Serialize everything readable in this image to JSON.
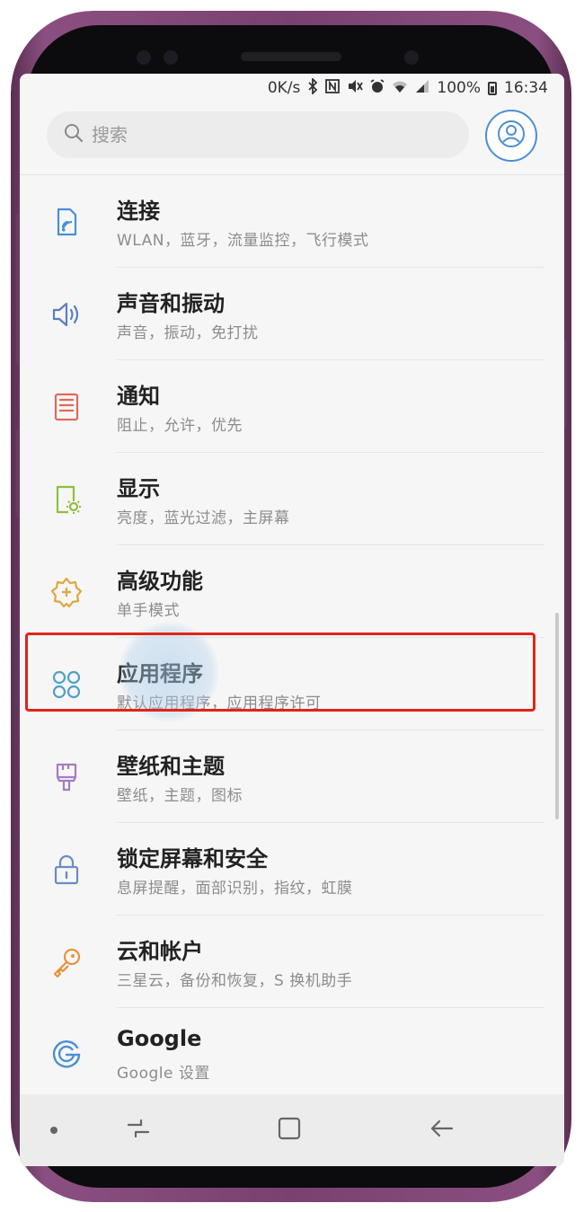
{
  "status_bar": {
    "speed": "0K/s",
    "battery": "100%",
    "time": "16:34",
    "icons": [
      "bluetooth-icon",
      "nfc-icon",
      "mute-icon",
      "alarm-icon",
      "wifi-icon",
      "signal-icon",
      "battery-icon"
    ]
  },
  "search": {
    "placeholder": "搜索"
  },
  "settings_items": [
    {
      "name": "connections",
      "icon": "connections-icon",
      "title": "连接",
      "subtitle": "WLAN，蓝牙，流量监控，飞行模式",
      "color": "#4a8fd6"
    },
    {
      "name": "sound",
      "icon": "speaker-icon",
      "title": "声音和振动",
      "subtitle": "声音，振动，免打扰",
      "color": "#5a7ec2"
    },
    {
      "name": "notifications",
      "icon": "notification-icon",
      "title": "通知",
      "subtitle": "阻止，允许，优先",
      "color": "#e06a5a"
    },
    {
      "name": "display",
      "icon": "display-icon",
      "title": "显示",
      "subtitle": "亮度，蓝光过滤，主屏幕",
      "color": "#8fbf3c"
    },
    {
      "name": "advanced",
      "icon": "advanced-features-icon",
      "title": "高级功能",
      "subtitle": "单手模式",
      "color": "#e0a63c"
    },
    {
      "name": "apps",
      "icon": "apps-icon",
      "title": "应用程序",
      "subtitle": "默认应用程序，应用程序许可",
      "color": "#4fa0c8"
    },
    {
      "name": "wallpaper",
      "icon": "brush-icon",
      "title": "壁纸和主题",
      "subtitle": "壁纸，主题，图标",
      "color": "#a47cc4"
    },
    {
      "name": "lockscreen",
      "icon": "lock-icon",
      "title": "锁定屏幕和安全",
      "subtitle": "息屏提醒，面部识别，指纹，虹膜",
      "color": "#6a8cc8"
    },
    {
      "name": "cloud",
      "icon": "key-icon",
      "title": "云和帐户",
      "subtitle": "三星云，备份和恢复，S 换机助手",
      "color": "#e8923c"
    },
    {
      "name": "google",
      "icon": "google-icon",
      "title": "Google",
      "subtitle": "Google 设置",
      "color": "#4a8fd6"
    }
  ],
  "colors": {
    "highlight": "#e2231a",
    "accent": "#4c8fd1"
  }
}
